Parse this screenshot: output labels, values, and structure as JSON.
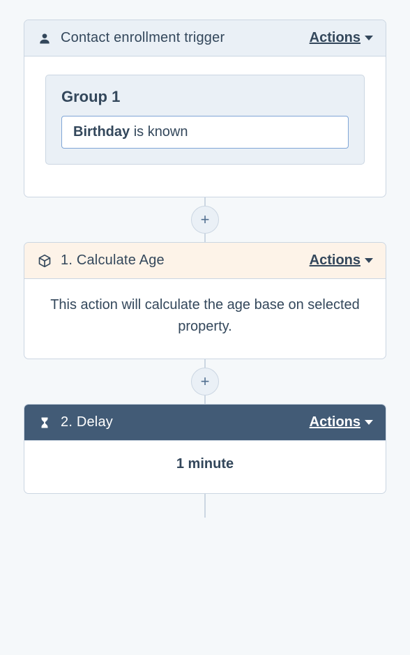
{
  "nodes": {
    "trigger": {
      "title": "Contact enrollment trigger",
      "actions_label": "Actions",
      "group_label": "Group 1",
      "filter_field": "Birthday",
      "filter_condition": "is known"
    },
    "calculate": {
      "title": "1. Calculate Age",
      "actions_label": "Actions",
      "description": "This action will calculate the age base on selected property."
    },
    "delay": {
      "title": "2. Delay",
      "actions_label": "Actions",
      "value": "1 minute"
    }
  },
  "buttons": {
    "add": "+"
  }
}
